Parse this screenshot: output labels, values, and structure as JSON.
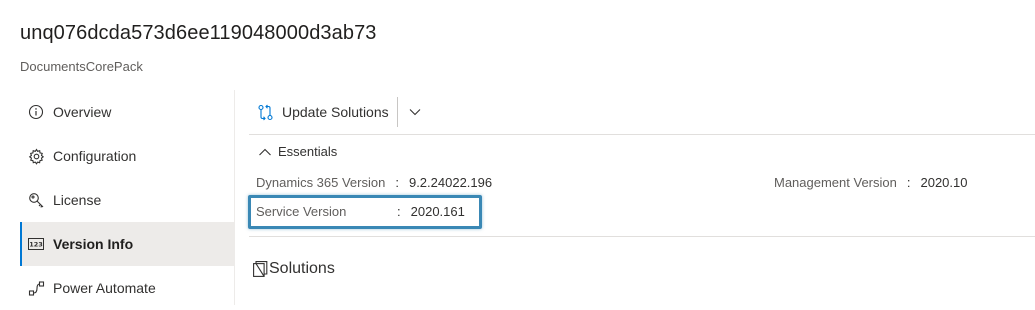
{
  "header": {
    "title": "unq076dcda573d6ee119048000d3ab73",
    "subtitle": "DocumentsCorePack"
  },
  "sidebar": {
    "items": [
      {
        "label": "Overview",
        "icon": "info-icon",
        "active": false
      },
      {
        "label": "Configuration",
        "icon": "gear-icon",
        "active": false
      },
      {
        "label": "License",
        "icon": "key-icon",
        "active": false
      },
      {
        "label": "Version Info",
        "icon": "version-number-icon",
        "active": true
      },
      {
        "label": "Power Automate",
        "icon": "flow-icon",
        "active": false
      }
    ]
  },
  "toolbar": {
    "update_label": "Update Solutions",
    "update_icon": "sync-icon",
    "dropdown_icon": "chevron-down-icon"
  },
  "essentials": {
    "toggle_label": "Essentials",
    "toggle_icon": "chevron-up-icon",
    "properties": [
      {
        "key": "Dynamics 365 Version",
        "value": "9.2.24022.196"
      },
      {
        "key": "Management Version",
        "value": "2020.10"
      },
      {
        "key": "Service Version",
        "value": "2020.161"
      }
    ]
  },
  "solutions": {
    "label": "Solutions",
    "icon": "solutions-icon"
  },
  "colors": {
    "accent": "#0078d4",
    "highlight_border": "#3a88b5",
    "active_bg": "#edebe9"
  }
}
